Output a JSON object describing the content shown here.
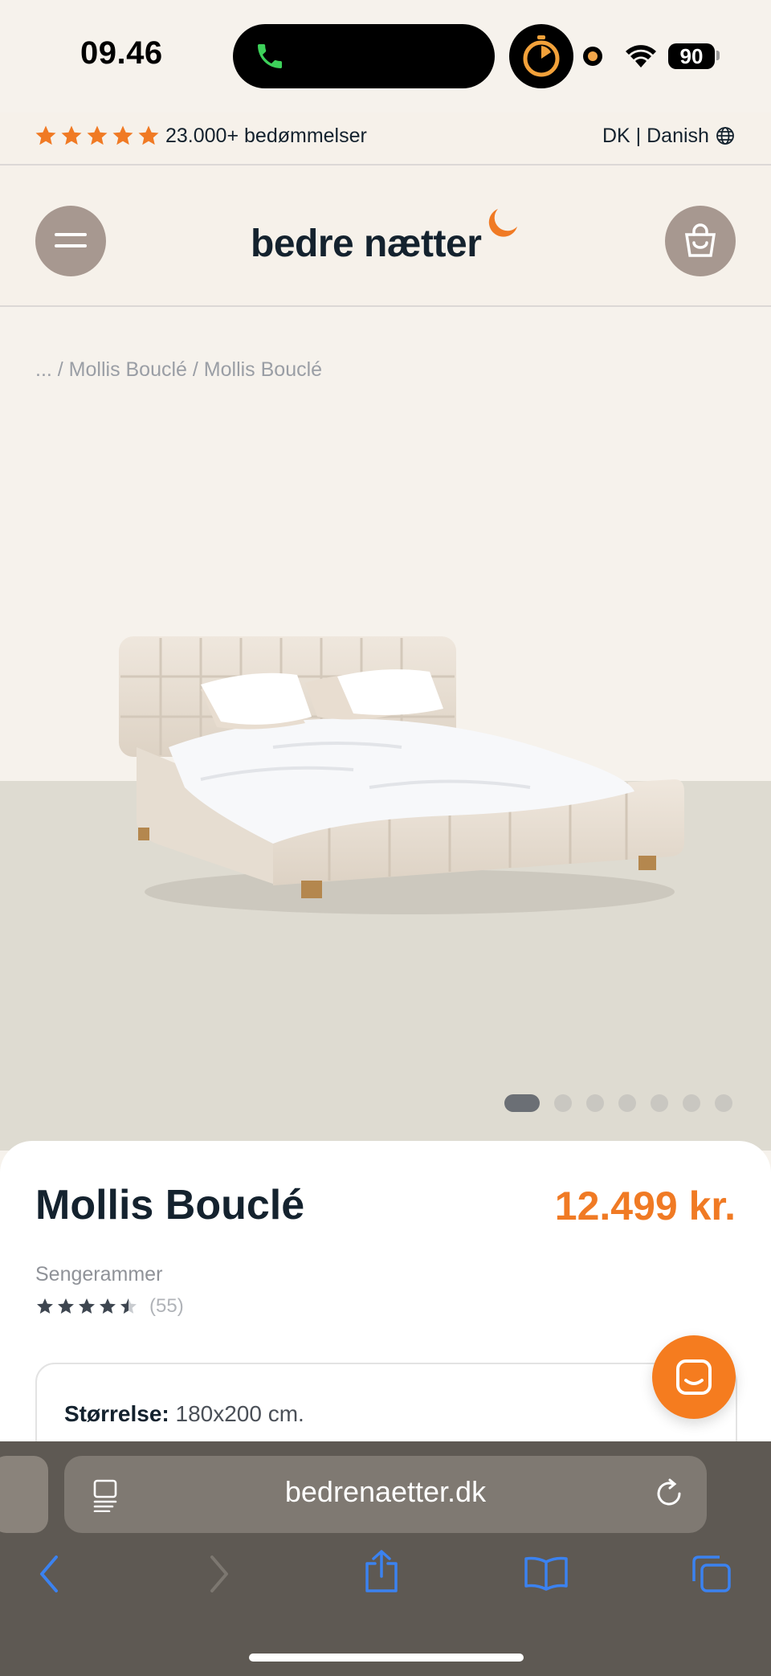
{
  "status_bar": {
    "time": "09.46",
    "battery": "90"
  },
  "top_bar": {
    "rating_text": "23.000+ bedømmelser",
    "locale": "DK | Danish",
    "star_color": "#f07a24"
  },
  "header": {
    "logo_text": "bedre nætter",
    "accent_color": "#f07a24"
  },
  "breadcrumb": {
    "text": "... / Mollis Bouclé / Mollis Bouclé"
  },
  "gallery": {
    "dot_count": 7,
    "active_index": 0
  },
  "product": {
    "title": "Mollis Bouclé",
    "price": "12.499 kr.",
    "category": "Sengerammer",
    "rating": 4.5,
    "review_count": "(55)",
    "size_label": "Størrelse:",
    "size_value": "180x200 cm."
  },
  "browser": {
    "url": "bedrenaetter.dk"
  },
  "icons": [
    "phone-icon",
    "timer-icon",
    "wifi-icon",
    "menu-icon",
    "cart-icon",
    "globe-icon",
    "chat-icon",
    "reader-icon",
    "reload-icon",
    "back-icon",
    "forward-icon",
    "share-icon",
    "bookmarks-icon",
    "tabs-icon"
  ]
}
